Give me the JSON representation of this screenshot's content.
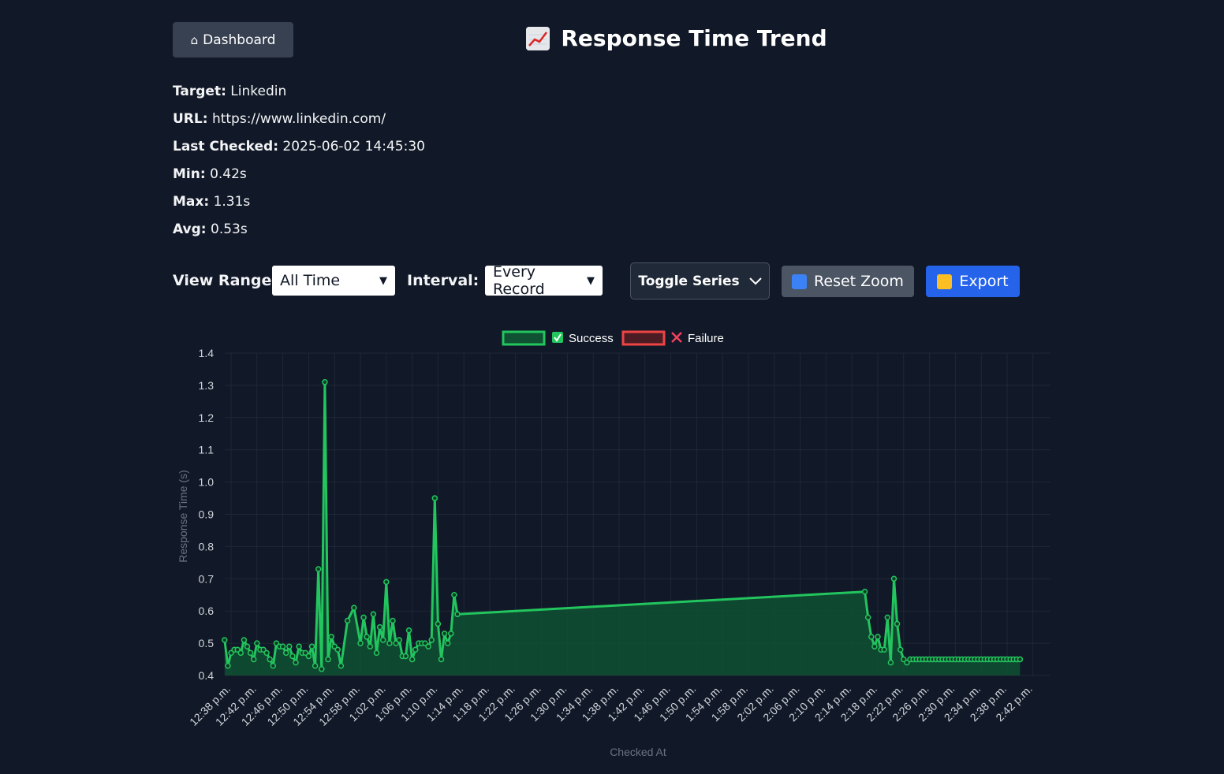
{
  "header": {
    "dashboard_label": "Dashboard",
    "dashboard_icon": "house-icon",
    "title": "Response Time Trend",
    "title_icon": "chart-increasing-icon"
  },
  "info": {
    "target_label": "Target:",
    "target_value": "Linkedin",
    "url_label": "URL:",
    "url_value": "https://www.linkedin.com/",
    "last_checked_label": "Last Checked:",
    "last_checked_value": "2025-06-02 14:45:30",
    "min_label": "Min:",
    "min_value": "0.42s",
    "max_label": "Max:",
    "max_value": "1.31s",
    "avg_label": "Avg:",
    "avg_value": "0.53s"
  },
  "controls": {
    "view_range_label": "View Range:",
    "view_range_value": "All Time",
    "interval_label": "Interval:",
    "interval_value": "Every Record",
    "toggle_series_label": "Toggle Series",
    "reset_zoom_label": "Reset Zoom",
    "export_label": "Export"
  },
  "colors": {
    "background": "#111827",
    "success": "#22c55e",
    "success_fill": "#0f5132",
    "failure": "#ef4444",
    "export": "#2563eb"
  },
  "chart_data": {
    "type": "line",
    "title": "",
    "xlabel": "Checked At",
    "ylabel": "Response Time (s)",
    "ylim": [
      0.4,
      1.4
    ],
    "y_ticks": [
      "0.4",
      "0.5",
      "0.6",
      "0.7",
      "0.8",
      "0.9",
      "1.0",
      "1.1",
      "1.2",
      "1.3",
      "1.4"
    ],
    "x_ticks": [
      "12:38 p.m.",
      "12:42 p.m.",
      "12:46 p.m.",
      "12:50 p.m.",
      "12:54 p.m.",
      "12:58 p.m.",
      "1:02 p.m.",
      "1:06 p.m.",
      "1:10 p.m.",
      "1:14 p.m.",
      "1:18 p.m.",
      "1:22 p.m.",
      "1:26 p.m.",
      "1:30 p.m.",
      "1:34 p.m.",
      "1:38 p.m.",
      "1:42 p.m.",
      "1:46 p.m.",
      "1:50 p.m.",
      "1:54 p.m.",
      "1:58 p.m.",
      "2:02 p.m.",
      "2:06 p.m.",
      "2:10 p.m.",
      "2:14 p.m.",
      "2:18 p.m.",
      "2:22 p.m.",
      "2:26 p.m.",
      "2:30 p.m.",
      "2:34 p.m.",
      "2:38 p.m.",
      "2:42 p.m."
    ],
    "grid": true,
    "legend_position": "top",
    "legend": [
      {
        "name": "Success",
        "marker": "check-icon"
      },
      {
        "name": "Failure",
        "marker": "cross-icon"
      }
    ],
    "series": [
      {
        "name": "Success",
        "x": [
          "12:37:00",
          "12:37:30",
          "12:38:00",
          "12:38:30",
          "12:39:00",
          "12:39:30",
          "12:40:00",
          "12:40:30",
          "12:41:00",
          "12:41:30",
          "12:42:00",
          "12:42:30",
          "12:43:00",
          "12:43:30",
          "12:44:00",
          "12:44:30",
          "12:45:00",
          "12:45:30",
          "12:46:00",
          "12:46:30",
          "12:47:00",
          "12:47:30",
          "12:48:00",
          "12:48:30",
          "12:49:00",
          "12:49:30",
          "12:50:00",
          "12:50:30",
          "12:51:00",
          "12:51:30",
          "12:52:00",
          "12:52:30",
          "12:53:00",
          "12:53:30",
          "12:54:00",
          "12:54:30",
          "12:55:00",
          "12:56:00",
          "12:57:00",
          "12:58:00",
          "12:58:30",
          "12:59:00",
          "12:59:30",
          "13:00:00",
          "13:00:30",
          "13:01:00",
          "13:01:30",
          "13:02:00",
          "13:02:30",
          "13:03:00",
          "13:03:30",
          "13:04:00",
          "13:04:30",
          "13:05:00",
          "13:05:30",
          "13:06:00",
          "13:06:30",
          "13:07:00",
          "13:07:30",
          "13:08:00",
          "13:08:30",
          "13:09:00",
          "13:09:30",
          "13:10:00",
          "13:10:30",
          "13:11:00",
          "13:11:30",
          "13:12:00",
          "13:12:30",
          "13:13:00",
          "14:16:00",
          "14:16:30",
          "14:17:00",
          "14:17:30",
          "14:18:00",
          "14:18:30",
          "14:19:00",
          "14:19:30",
          "14:20:00",
          "14:20:30",
          "14:21:00",
          "14:21:30",
          "14:22:00",
          "14:22:30",
          "14:23:00",
          "14:23:30",
          "14:24:00",
          "14:24:30",
          "14:25:00",
          "14:25:30",
          "14:26:00",
          "14:26:30",
          "14:27:00",
          "14:27:30",
          "14:28:00",
          "14:28:30",
          "14:29:00",
          "14:29:30",
          "14:30:00",
          "14:30:30",
          "14:31:00",
          "14:31:30",
          "14:32:00",
          "14:32:30",
          "14:33:00",
          "14:33:30",
          "14:34:00",
          "14:34:30",
          "14:35:00",
          "14:35:30",
          "14:36:00",
          "14:36:30",
          "14:37:00",
          "14:37:30",
          "14:38:00",
          "14:38:30",
          "14:39:00",
          "14:39:30",
          "14:40:00"
        ],
        "values": [
          0.51,
          0.43,
          0.47,
          0.48,
          0.48,
          0.47,
          0.51,
          0.49,
          0.47,
          0.45,
          0.5,
          0.48,
          0.48,
          0.47,
          0.45,
          0.43,
          0.5,
          0.49,
          0.49,
          0.47,
          0.49,
          0.46,
          0.44,
          0.49,
          0.47,
          0.47,
          0.46,
          0.49,
          0.43,
          0.73,
          0.42,
          1.31,
          0.45,
          0.52,
          0.49,
          0.48,
          0.43,
          0.57,
          0.61,
          0.5,
          0.58,
          0.52,
          0.49,
          0.59,
          0.47,
          0.55,
          0.51,
          0.69,
          0.5,
          0.57,
          0.5,
          0.51,
          0.46,
          0.46,
          0.54,
          0.45,
          0.48,
          0.5,
          0.5,
          0.5,
          0.49,
          0.51,
          0.95,
          0.56,
          0.45,
          0.53,
          0.5,
          0.53,
          0.65,
          0.59,
          0.66,
          0.58,
          0.52,
          0.49,
          0.52,
          0.48,
          0.48,
          0.58,
          0.44,
          0.7,
          0.56,
          0.48,
          0.45,
          0.44,
          0.45,
          0.45,
          0.45,
          0.45,
          0.45,
          0.45,
          0.45,
          0.45,
          0.45,
          0.45,
          0.45,
          0.45,
          0.45,
          0.45,
          0.45,
          0.45,
          0.45,
          0.45,
          0.45,
          0.45,
          0.45,
          0.45,
          0.45,
          0.45,
          0.45,
          0.45,
          0.45,
          0.45,
          0.45,
          0.45,
          0.45,
          0.45,
          0.45,
          0.45,
          0.45
        ]
      },
      {
        "name": "Failure",
        "x": [],
        "values": []
      }
    ]
  }
}
